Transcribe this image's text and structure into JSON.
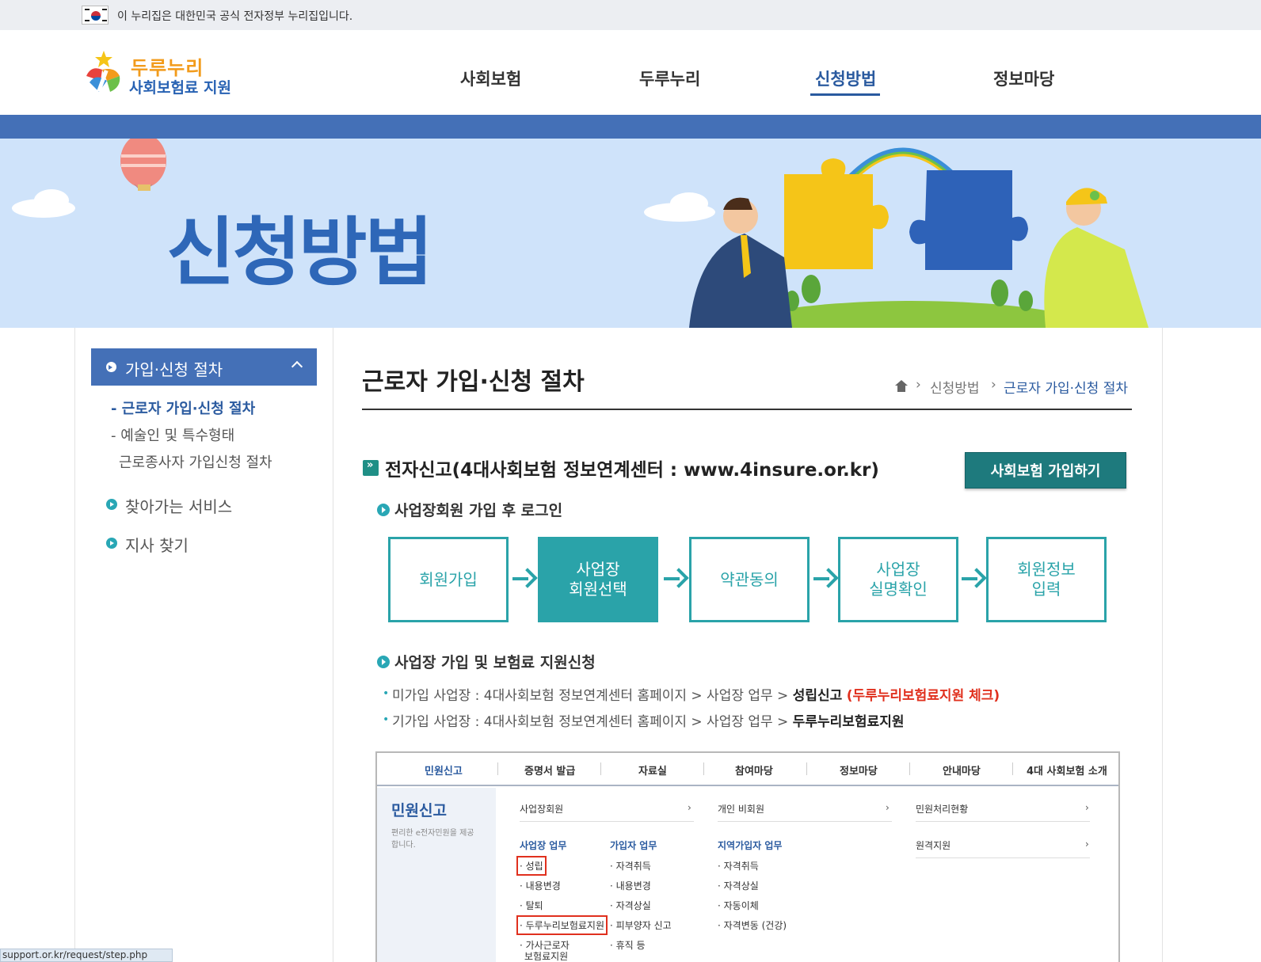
{
  "gov_banner": {
    "text": "이 누리집은 대한민국 공식 전자정부 누리집입니다."
  },
  "logo": {
    "line1": "두루누리",
    "line2": "사회보험료 지원"
  },
  "nav": [
    {
      "label": "사회보험",
      "active": false
    },
    {
      "label": "두루누리",
      "active": false
    },
    {
      "label": "신청방법",
      "active": true
    },
    {
      "label": "정보마당",
      "active": false
    }
  ],
  "visual": {
    "title": "신청방법"
  },
  "sidebar": {
    "heading": "가입·신청 절차",
    "sub_items": [
      {
        "label": "- 근로자 가입·신청 절차",
        "active": true
      },
      {
        "label": "- 예술인 및 특수형태",
        "active": false
      },
      {
        "label": "근로종사자 가입신청 절차",
        "active": false
      }
    ],
    "links": [
      {
        "label": "찾아가는 서비스"
      },
      {
        "label": "지사 찾기"
      }
    ]
  },
  "page": {
    "title": "근로자 가입·신청 절차",
    "breadcrumb": [
      "신청방법",
      "근로자 가입·신청 절차"
    ]
  },
  "section": {
    "title": "전자신고(4대사회보험 정보연계센터 : www.4insure.or.kr)",
    "button_label": "사회보험 가입하기",
    "step_heading": "사업장회원 가입 후 로그인",
    "steps": [
      {
        "label": "회원가입",
        "active": false
      },
      {
        "label": "사업장\n회원선택",
        "active": true
      },
      {
        "label": "약관동의",
        "active": false
      },
      {
        "label": "사업장\n실명확인",
        "active": false
      },
      {
        "label": "회원정보\n입력",
        "active": false
      }
    ],
    "apply_heading": "사업장 가입 및 보험료 지원신청",
    "lines": [
      {
        "text": "미가입 사업장 : 4대사회보험 정보연계센터 홈페이지 > 사업장 업무 > ",
        "strong": "성립신고",
        "red": "(두루누리보험료지원 체크)"
      },
      {
        "text": "기가입 사업장 : 4대사회보험 정보연계센터 홈페이지 > 사업장 업무 > ",
        "strong": "두루누리보험료지원",
        "red": ""
      }
    ]
  },
  "screenshot": {
    "nav": [
      "민원신고",
      "증명서 발급",
      "자료실",
      "참여마당",
      "정보마당",
      "안내마당",
      "4대 사회보험 소개"
    ],
    "side_title": "민원신고",
    "side_desc": "편리한 e전자민원을 제공합니다.",
    "col1_header": "사업장회원",
    "col2_header": "개인 비회원",
    "col3_header": "민원처리현황",
    "col3_item2": "원격지원",
    "group1_title": "사업장 업무",
    "group1_items": [
      "· 성립",
      "· 내용변경",
      "· 탈퇴",
      "· 두루누리보험료지원",
      "· 가사근로자",
      "보험료지원"
    ],
    "group2_title": "가입자 업무",
    "group2_items": [
      "· 자격취득",
      "· 내용변경",
      "· 자격상실",
      "· 피부양자 신고",
      "· 휴직 등"
    ],
    "group3_title": "지역가입자 업무",
    "group3_items": [
      "· 자격취득",
      "· 자격상실",
      "· 자동이체",
      "· 자격변동 (건강)"
    ]
  },
  "status_bar": {
    "url": "support.or.kr/request/step.php"
  },
  "colors": {
    "primary_blue": "#4470b7",
    "teal": "#2aa3a9",
    "button_teal": "#1e7a7d",
    "highlight_red": "#e0301e"
  }
}
